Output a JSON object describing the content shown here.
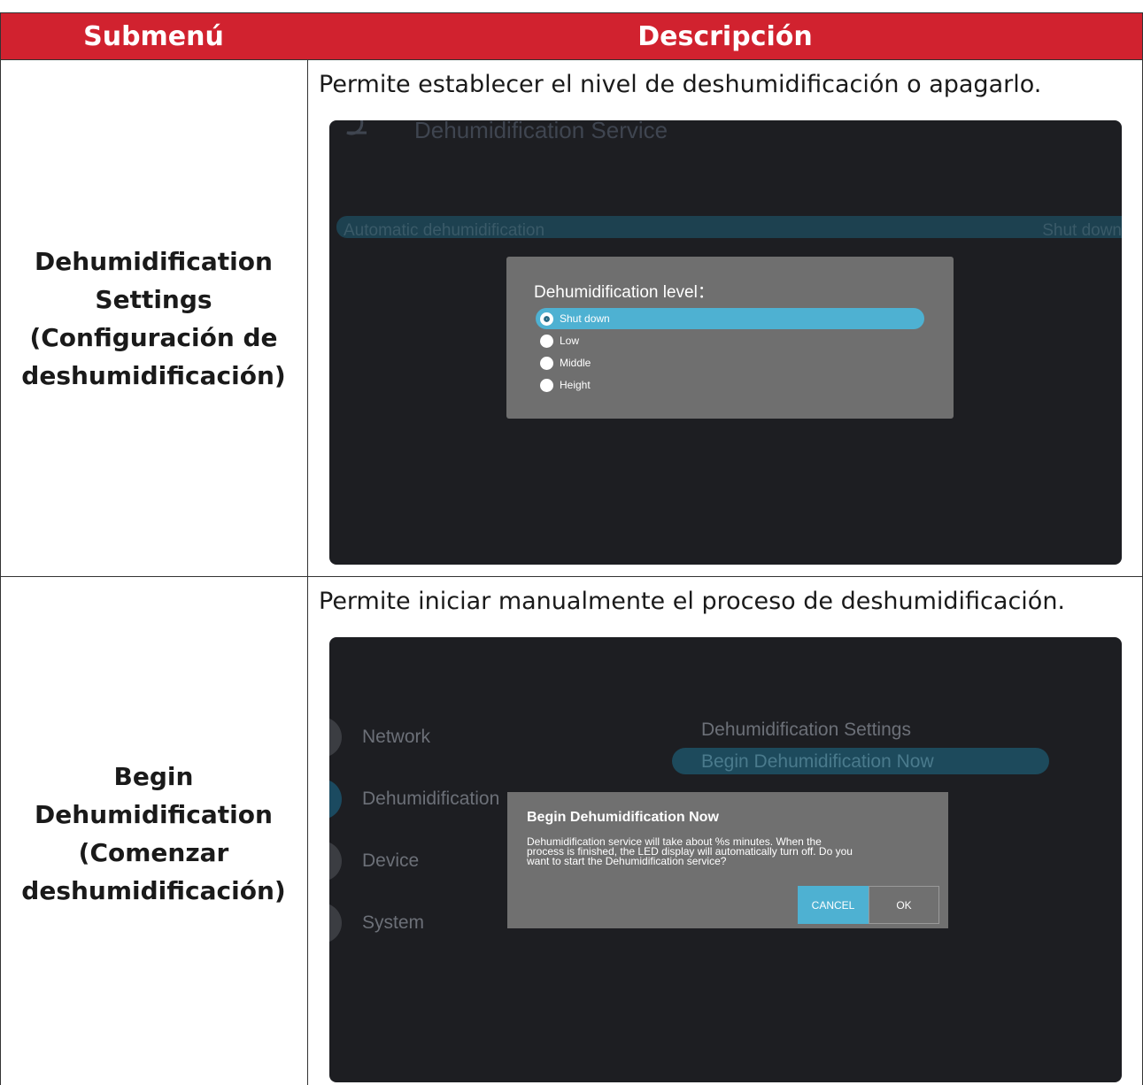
{
  "table": {
    "headers": {
      "submenu": "Submenú",
      "description": "Descripción"
    },
    "rows": [
      {
        "submenu_lines": [
          "Dehumidification",
          "Settings",
          "(Configuración de",
          "deshumidificación)"
        ],
        "description": "Permite establecer el nivel de deshumidificación o apagarlo.",
        "screen": {
          "title": "Dehumidification Service",
          "setting_label": "Automatic dehumidification",
          "setting_value": "Shut down",
          "dialog": {
            "title": "Dehumidification level：",
            "options": [
              "Shut down",
              "Low",
              "Middle",
              "Height"
            ],
            "selected": "Shut down"
          }
        }
      },
      {
        "submenu_lines": [
          "Begin",
          "Dehumidification",
          "(Comenzar",
          "deshumidificación)"
        ],
        "description": "Permite iniciar manualmente el proceso de deshumidificación.",
        "screen": {
          "nav_items": [
            "Network",
            "Dehumidification",
            "Device",
            "System"
          ],
          "right_items": [
            "Dehumidification Settings",
            "Begin Dehumidification Now"
          ],
          "dialog": {
            "title": "Begin Dehumidification Now",
            "body_lines": [
              "Dehumidification service will take about %s minutes. When the",
              "process is finished, the LED display will automatically turn off. Do you",
              "want to start the Dehumidification service?"
            ],
            "cancel": "CANCEL",
            "ok": "OK"
          }
        }
      }
    ]
  },
  "colors": {
    "header_bg": "#d1222f",
    "screen_bg": "#1d1e22",
    "dialog_bg": "#707070",
    "accent": "#4eb1d2"
  }
}
